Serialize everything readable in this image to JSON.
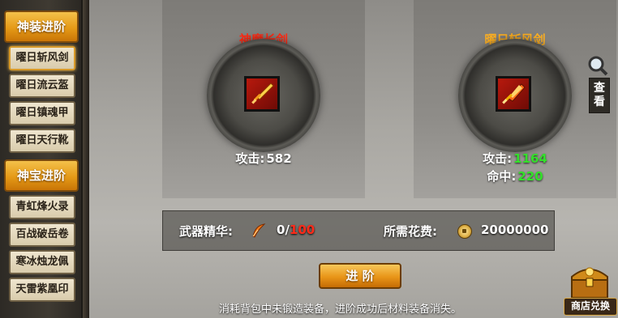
{
  "sidebar": {
    "category1": "神装进阶",
    "equip_items": [
      "曜日斩风剑",
      "曜日流云盔",
      "曜日镇魂甲",
      "曜日天行靴"
    ],
    "category2": "神宝进阶",
    "treasure_items": [
      "青虹烽火录",
      "百战破岳卷",
      "寒冰烛龙佩",
      "天雷紫凰印"
    ]
  },
  "left_weapon": {
    "name": "神魔长剑",
    "attack_label": "攻击:",
    "attack": "582"
  },
  "right_weapon": {
    "name": "曜日斩风剑",
    "attack_label": "攻击:",
    "attack": "1164",
    "hit_label": "命中:",
    "hit": "220"
  },
  "cost": {
    "essence_label": "武器精华:",
    "essence_have": "0",
    "essence_sep": "/",
    "essence_need": "100",
    "fee_label": "所需花费:",
    "fee": "20000000"
  },
  "advance_label": "进 阶",
  "notice": "消耗背包中未锻造装备，进阶成功后材料装备消失。",
  "view_label": "查看",
  "shop_label": "商店兑换",
  "colors": {
    "name_red": "#ff2a14",
    "name_orange": "#ffb020",
    "green": "#33e02a",
    "red": "#ff2b1a"
  },
  "icons": {
    "view": "magnifier-icon",
    "essence": "feather-icon",
    "fee": "coin-icon",
    "shop": "treasure-chest-icon"
  }
}
